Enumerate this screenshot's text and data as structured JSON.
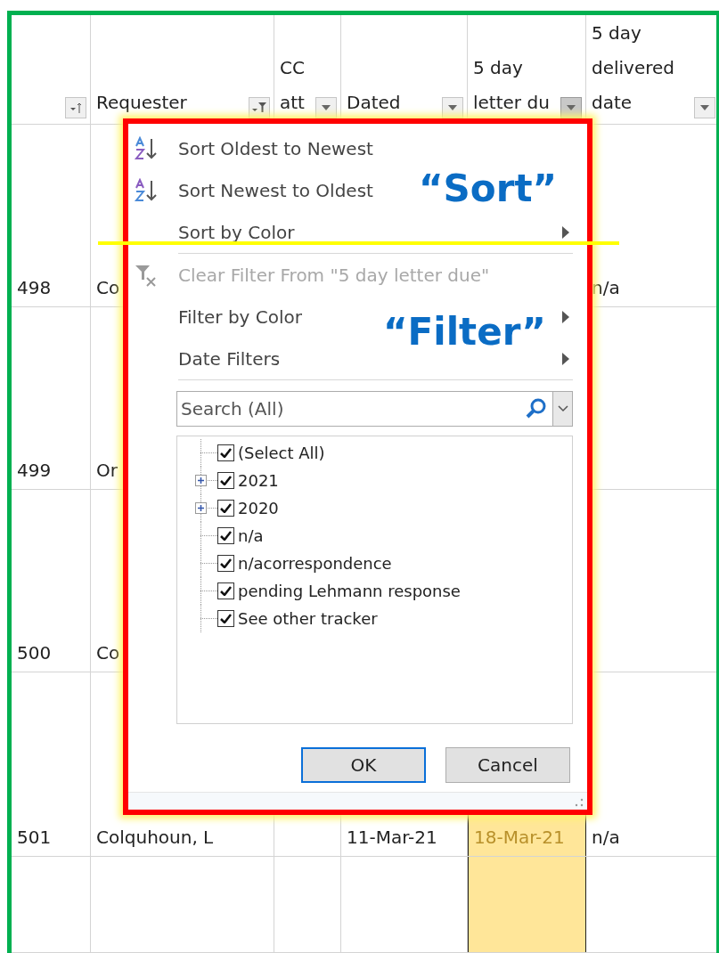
{
  "table": {
    "columns": [
      {
        "kind": "sort",
        "active": false
      },
      {
        "lines": [
          "Requester"
        ],
        "kind": "filter",
        "active": false
      },
      {
        "lines": [
          "CC",
          "att"
        ],
        "kind": "dropdown",
        "active": false
      },
      {
        "lines": [
          "Dated"
        ],
        "kind": "dropdown",
        "active": false
      },
      {
        "lines": [
          "5 day",
          "letter du"
        ],
        "kind": "dropdown",
        "active": true
      },
      {
        "lines": [
          "5 day",
          "delivered",
          "date"
        ],
        "kind": "dropdown",
        "active": false
      }
    ],
    "rows": [
      {
        "cells": [
          "498",
          "Co",
          null,
          null,
          null,
          "n/a"
        ]
      },
      {
        "cells": [
          "499",
          "Or",
          null,
          null,
          null,
          null
        ]
      },
      {
        "cells": [
          "500",
          "Co",
          null,
          null,
          null,
          null
        ]
      },
      {
        "cells": [
          "501",
          "Colquhoun, L",
          null,
          "11-Mar-21",
          "18-Mar-21",
          "n/a"
        ],
        "due_highlighted": true
      },
      {
        "cells": [
          null,
          null,
          null,
          null,
          null,
          null
        ],
        "due_highlighted": true
      }
    ]
  },
  "filter_menu": {
    "items": [
      {
        "label": "Sort Oldest to Newest",
        "kind": "ascending",
        "disabled": false
      },
      {
        "label": "Sort Newest to Oldest",
        "kind": "descending",
        "disabled": false
      },
      {
        "label": "Sort by Color",
        "kind": "plain",
        "disabled": false,
        "submenu": true,
        "separator_after": true
      },
      {
        "label": "Clear Filter From \"5 day letter due\"",
        "kind": "clear",
        "disabled": true
      },
      {
        "label": "Filter by Color",
        "kind": "plain",
        "disabled": false,
        "submenu": true
      },
      {
        "label": "Date Filters",
        "kind": "plain",
        "disabled": false,
        "submenu": true,
        "separator_after": true
      }
    ],
    "search": {
      "placeholder": "Search (All)"
    },
    "values": [
      {
        "label": "(Select All)",
        "checked": true,
        "expandable": false
      },
      {
        "label": "2021",
        "checked": true,
        "expandable": true
      },
      {
        "label": "2020",
        "checked": true,
        "expandable": true
      },
      {
        "label": "n/a",
        "checked": true,
        "expandable": false
      },
      {
        "label": "n/acorrespondence",
        "checked": true,
        "expandable": false
      },
      {
        "label": "pending Lehmann response",
        "checked": true,
        "expandable": false
      },
      {
        "label": "See other tracker",
        "checked": true,
        "expandable": false
      }
    ],
    "buttons": [
      {
        "label": "OK",
        "default": true
      },
      {
        "label": "Cancel",
        "default": false
      }
    ]
  },
  "annotations": [
    {
      "kind": "sort",
      "text": "“Sort”"
    },
    {
      "kind": "filter",
      "text": "“Filter”"
    }
  ]
}
